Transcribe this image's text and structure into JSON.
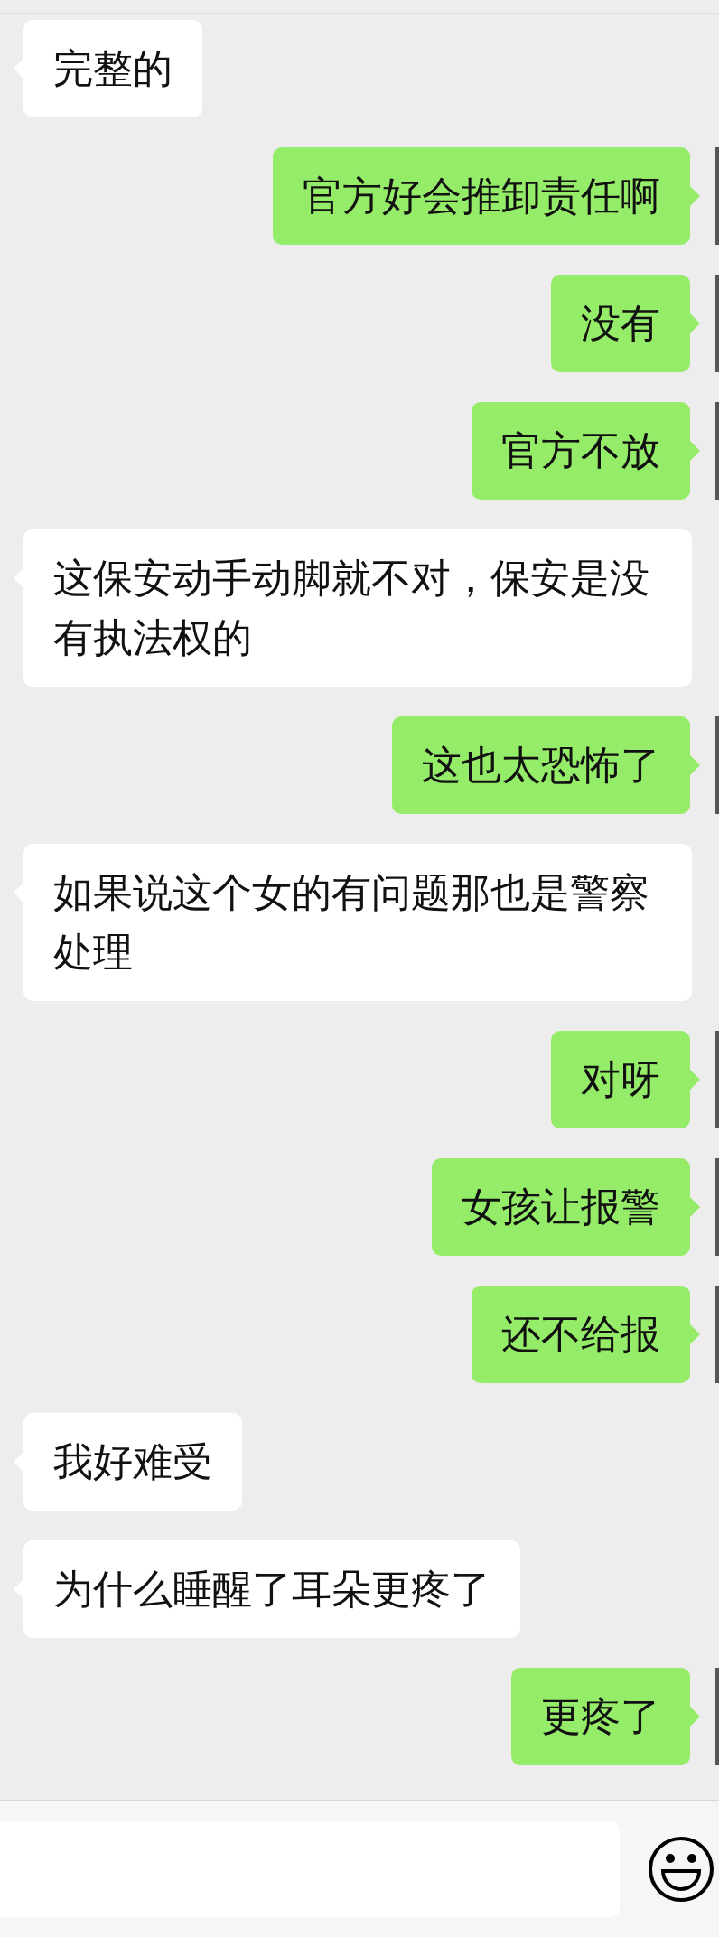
{
  "messages": [
    {
      "kind": "received",
      "text": "完整的"
    },
    {
      "kind": "sent",
      "text": "官方好会推卸责任啊"
    },
    {
      "kind": "sent",
      "text": "没有"
    },
    {
      "kind": "sent",
      "text": "官方不放"
    },
    {
      "kind": "received",
      "text": "这保安动手动脚就不对，保安是没有执法权的"
    },
    {
      "kind": "sent",
      "text": "这也太恐怖了"
    },
    {
      "kind": "received",
      "text": "如果说这个女的有问题那也是警察处理"
    },
    {
      "kind": "sent",
      "text": "对呀"
    },
    {
      "kind": "sent",
      "text": "女孩让报警"
    },
    {
      "kind": "sent",
      "text": "还不给报"
    },
    {
      "kind": "received",
      "text": "我好难受"
    },
    {
      "kind": "received",
      "text": "为什么睡醒了耳朵更疼了"
    },
    {
      "kind": "sent",
      "text": "更疼了"
    }
  ]
}
